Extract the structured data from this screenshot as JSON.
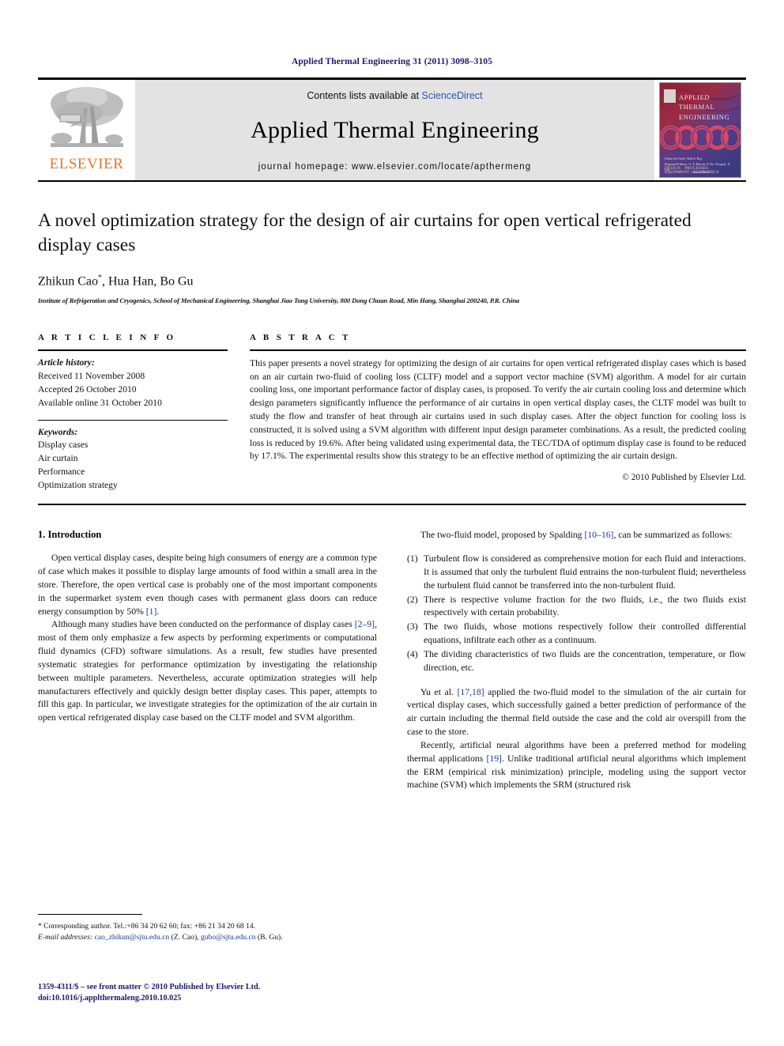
{
  "running_head": "Applied Thermal Engineering 31 (2011) 3098–3105",
  "masthead": {
    "contents_prefix": "Contents lists available at ",
    "sciencedirect": "ScienceDirect",
    "journal_name": "Applied Thermal Engineering",
    "homepage": "journal homepage: www.elsevier.com/locate/apthermeng",
    "publisher_wordmark": "ELSEVIER",
    "accent_orange": "#E87722",
    "link_blue": "#2b56b5"
  },
  "cover": {
    "title_line1": "APPLIED",
    "title_line2": "THERMAL",
    "title_line3": "ENGINEERING",
    "editors_line1": "Editor-in-Chief: Neil S. Roy",
    "editors_line2": "Regional Editors: G. F. Hewitt, P. De. Pasqual, X. Liu",
    "keywords": "DESIGN  ·  PROCESSES  ·  EQUIPMENT  ·  ECONOMICS",
    "footer": "ScienceDirect"
  },
  "article": {
    "title": "A novel optimization strategy for the design of air curtains for open vertical refrigerated display cases",
    "authors": "Zhikun Cao",
    "author_marker": "*",
    "authors_rest": ", Hua Han, Bo Gu",
    "affiliation": "Institute of Refrigeration and Cryogenics, School of Mechanical Engineering, Shanghai Jiao Tong University, 800 Dong Chuan Road, Min Hang, Shanghai 200240, P.R. China"
  },
  "info": {
    "heading": "A R T I C L E   I N F O",
    "history_label": "Article history:",
    "history": [
      "Received 11 November 2008",
      "Accepted 26 October 2010",
      "Available online 31 October 2010"
    ],
    "keywords_label": "Keywords:",
    "keywords": [
      "Display cases",
      "Air curtain",
      "Performance",
      "Optimization strategy"
    ]
  },
  "abstract": {
    "heading": "A B S T R A C T",
    "text": "This paper presents a novel strategy for optimizing the design of air curtains for open vertical refrigerated display cases which is based on an air curtain two-fluid of cooling loss (CLTF) model and a support vector machine (SVM) algorithm. A model for air curtain cooling loss, one important performance factor of display cases, is proposed. To verify the air curtain cooling loss and determine which design parameters significantly influence the performance of air curtains in open vertical display cases, the CLTF model was built to study the flow and transfer of heat through air curtains used in such display cases. After the object function for cooling loss is constructed, it is solved using a SVM algorithm with different input design parameter combinations. As a result, the predicted cooling loss is reduced by 19.6%. After being validated using experimental data, the TEC/TDA of optimum display case is found to be reduced by 17.1%. The experimental results show this strategy to be an effective method of optimizing the air curtain design.",
    "copyright": "© 2010 Published by Elsevier Ltd."
  },
  "body": {
    "section_title": "1.  Introduction",
    "left_p1_a": "Open vertical display cases, despite being high consumers of energy are a common type of case which makes it possible to display large amounts of food within a small area in the store. Therefore, the open vertical case is probably one of the most important components in the supermarket system even though cases with permanent glass doors can reduce energy consumption by 50% ",
    "left_p1_cite": "[1]",
    "left_p1_b": ".",
    "left_p2_a": "Although many studies have been conducted on the performance of display cases ",
    "left_p2_cite": "[2–9]",
    "left_p2_b": ", most of them only emphasize a few aspects by performing experiments or computational fluid dynamics (CFD) software simulations. As a result, few studies have presented systematic strategies for performance optimization by investigating the relationship between multiple parameters. Nevertheless, accurate optimization strategies will help manufacturers effectively and quickly design better display cases. This paper, attempts to fill this gap. In particular, we investigate strategies for the optimization of the air curtain in open vertical refrigerated display case based on the CLTF model and SVM algorithm.",
    "right_p1_a": "The two-fluid model, proposed by Spalding ",
    "right_p1_cite": "[10–16]",
    "right_p1_b": ", can be summarized as follows:",
    "list": [
      {
        "marker": "(1)",
        "text": "Turbulent flow is considered as comprehensive motion for each fluid and interactions. It is assumed that only the turbulent fluid entrains the non-turbulent fluid; nevertheless the turbulent fluid cannot be transferred into the non-turbulent fluid."
      },
      {
        "marker": "(2)",
        "text": "There is respective volume fraction for the two fluids, i.e., the two fluids exist respectively with certain probability."
      },
      {
        "marker": "(3)",
        "text": "The two fluids, whose motions respectively follow their controlled differential equations, infiltrate each other as a continuum."
      },
      {
        "marker": "(4)",
        "text": "The dividing characteristics of two fluids are the concentration, temperature, or flow direction, etc."
      }
    ],
    "right_p2_a": "Yu et al. ",
    "right_p2_cite": "[17,18]",
    "right_p2_b": " applied the two-fluid model to the simulation of the air curtain for vertical display cases, which successfully gained a better prediction of performance of the air curtain including the thermal field outside the case and the cold air overspill from the case to the store.",
    "right_p3_a": "Recently, artificial neural algorithms have been a preferred method for modeling thermal applications ",
    "right_p3_cite": "[19]",
    "right_p3_b": ". Unlike traditional artificial neural algorithms which implement the ERM (empirical risk minimization) principle, modeling using the support vector machine (SVM) which implements the SRM (structured risk"
  },
  "footnotes": {
    "corresponding": "* Corresponding author. Tel.:+86 34 20 62 60; fax: +86 21 34 20 68 14.",
    "email_label": "E-mail addresses:",
    "email1": "cao_zhikun@sjtu.edu.cn",
    "email1_who": " (Z. Cao), ",
    "email2": "gubo@sjtu.edu.cn",
    "email2_who": " (B. Gu)."
  },
  "colophon": {
    "line1": "1359-4311/$ – see front matter © 2010 Published by Elsevier Ltd.",
    "line2": "doi:10.1016/j.applthermaleng.2010.10.025"
  }
}
